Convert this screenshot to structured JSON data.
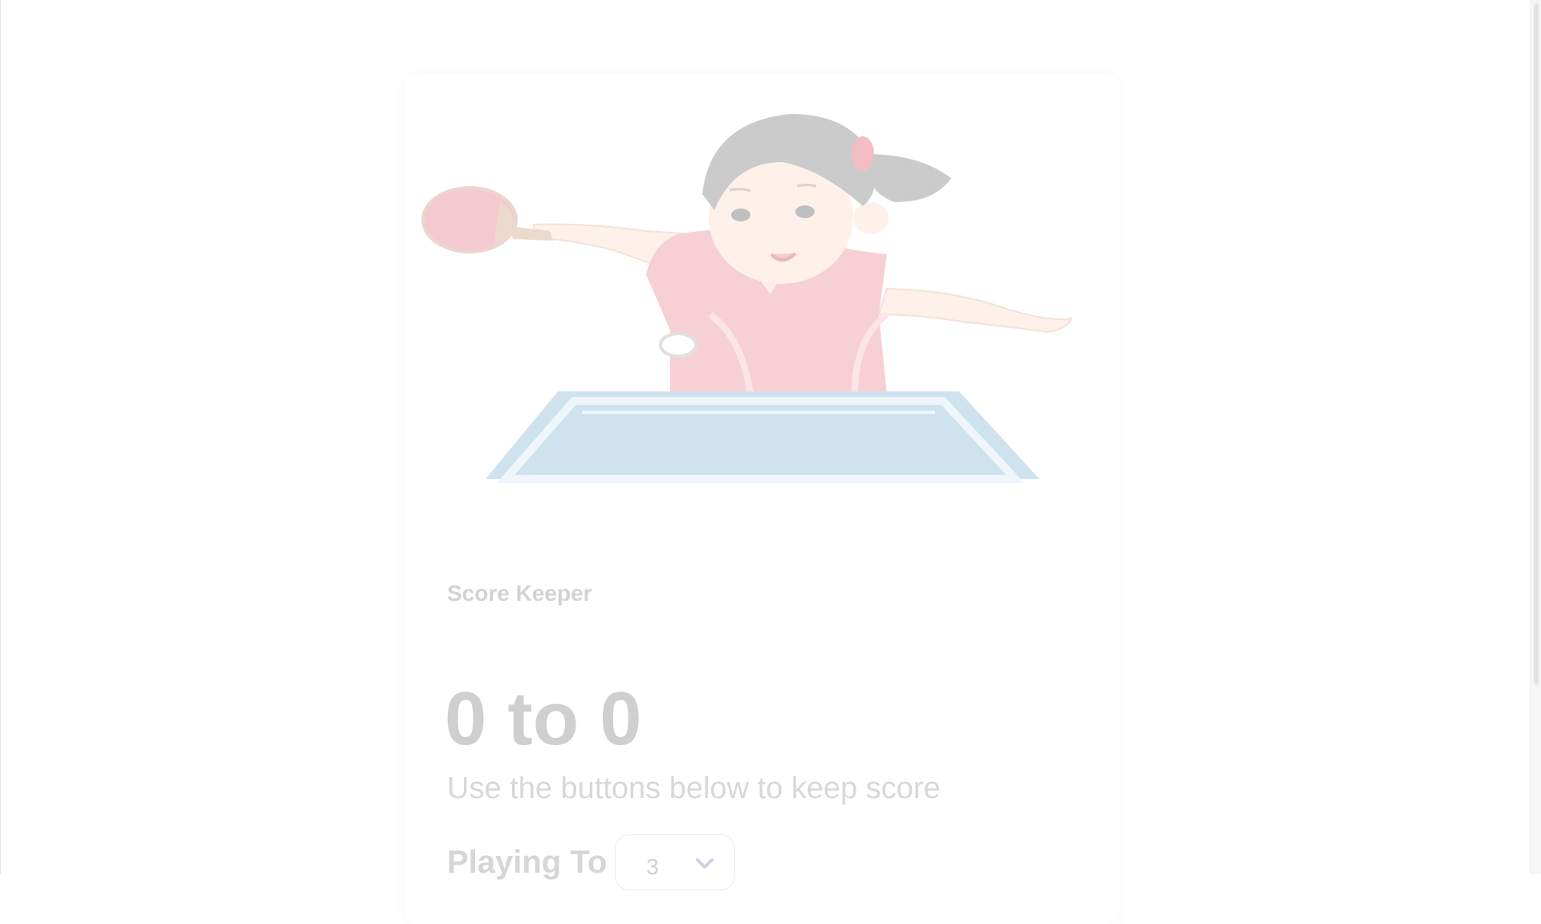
{
  "app": {
    "title": "Score Keeper"
  },
  "score": {
    "player1": "0",
    "separator": "to",
    "player2": "0",
    "display": "0 to 0"
  },
  "subtitle": "Use the buttons below to keep score",
  "playing_to": {
    "label": "Playing To",
    "selected_value": "3"
  },
  "hero_image": {
    "subject": "girl playing table tennis illustration"
  },
  "colors": {
    "table_blue": "#cfe3ef",
    "shirt_pink": "#f7d0d5",
    "paddle_red": "#f4c9cf",
    "hair_gray": "#cbcbcb",
    "skin": "#fdf1ea",
    "heading_gray": "#d3d3d3"
  }
}
